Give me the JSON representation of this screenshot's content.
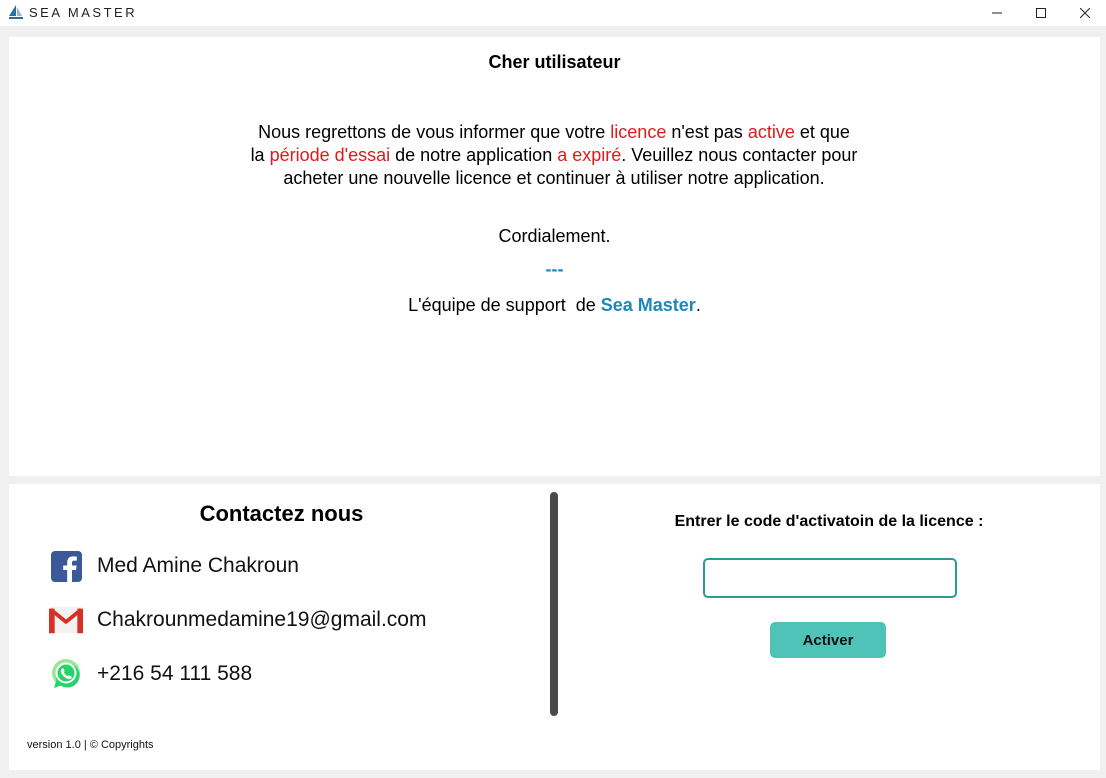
{
  "window": {
    "title": "SEA MASTER",
    "logo_icon": "sailboat-logo-icon",
    "controls": [
      "minimize-icon",
      "maximize-icon",
      "close-icon"
    ]
  },
  "message": {
    "greeting": "Cher utilisateur",
    "body_parts": [
      {
        "text": "Nous regrettons de vous informer que votre ",
        "highlight": false
      },
      {
        "text": "licence",
        "highlight": true
      },
      {
        "text": " n'est pas ",
        "highlight": false
      },
      {
        "text": "active",
        "highlight": true
      },
      {
        "text": " et que la ",
        "highlight": false
      },
      {
        "text": "période d'essai",
        "highlight": true
      },
      {
        "text": " de notre application ",
        "highlight": false
      },
      {
        "text": "a expiré",
        "highlight": true
      },
      {
        "text": ". Veuillez nous contacter pour acheter une nouvelle licence et continuer à utiliser notre application.",
        "highlight": false
      }
    ],
    "closing": "Cordialement.",
    "separator": "---",
    "signature_prefix": "L'équipe de support  de ",
    "signature_brand": "Sea Master",
    "signature_suffix": "."
  },
  "contact": {
    "title": "Contactez nous",
    "items": [
      {
        "icon": "facebook-icon",
        "text": "Med Amine Chakroun"
      },
      {
        "icon": "gmail-icon",
        "text": "Chakrounmedamine19@gmail.com"
      },
      {
        "icon": "whatsapp-icon",
        "text": "+216 54 111 588"
      }
    ]
  },
  "license": {
    "label": "Entrer le code d'activatoin de la licence :",
    "input_value": "",
    "button_label": "Activer"
  },
  "footer": {
    "version": "version 1.0 | © Copyrights"
  },
  "colors": {
    "highlight_red": "#e01a1a",
    "brand_blue": "#1e88b8",
    "button_teal": "#4fc3b8",
    "input_border": "#2a9d8f"
  }
}
